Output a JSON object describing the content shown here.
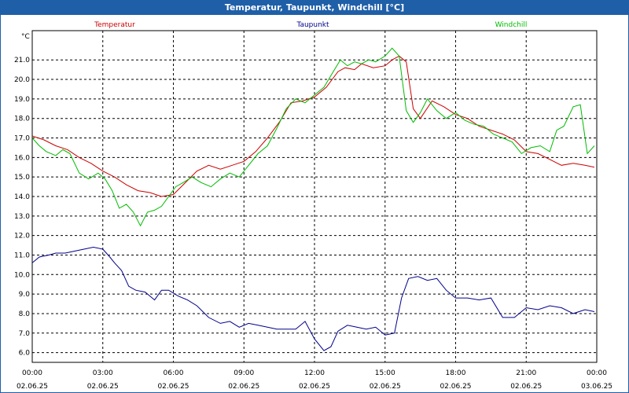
{
  "window": {
    "title": "Temperatur, Taupunkt, Windchill [°C]"
  },
  "chart_data": {
    "type": "line",
    "ylabel": "°C",
    "ylim": [
      5.5,
      22.5
    ],
    "yticks": [
      6.0,
      7.0,
      8.0,
      9.0,
      10.0,
      11.0,
      12.0,
      13.0,
      14.0,
      15.0,
      16.0,
      17.0,
      18.0,
      19.0,
      20.0,
      21.0
    ],
    "xlim": [
      0,
      24
    ],
    "xticks": [
      {
        "time": "00:00",
        "date": "02.06.25"
      },
      {
        "time": "03:00",
        "date": "02.06.25"
      },
      {
        "time": "06:00",
        "date": "02.06.25"
      },
      {
        "time": "09:00",
        "date": "02.06.25"
      },
      {
        "time": "12:00",
        "date": "02.06.25"
      },
      {
        "time": "15:00",
        "date": "02.06.25"
      },
      {
        "time": "18:00",
        "date": "02.06.25"
      },
      {
        "time": "21:00",
        "date": "02.06.25"
      },
      {
        "time": "00:00",
        "date": "03.06.25"
      }
    ],
    "grid": true,
    "legend": "top",
    "series": [
      {
        "name": "Temperatur",
        "color": "#cc0000",
        "x": [
          0,
          0.5,
          1,
          1.5,
          2,
          2.5,
          3,
          3.5,
          4,
          4.5,
          5,
          5.5,
          6,
          6.5,
          7,
          7.5,
          8,
          8.5,
          9,
          9.5,
          10,
          10.5,
          11,
          11.5,
          12,
          12.5,
          13,
          13.3,
          13.7,
          14,
          14.5,
          15,
          15.3,
          15.6,
          15.9,
          16.2,
          16.5,
          17,
          17.5,
          18,
          18.5,
          19,
          19.5,
          20,
          20.5,
          21,
          21.5,
          22,
          22.5,
          23,
          23.5,
          23.9
        ],
        "y": [
          17.1,
          16.9,
          16.6,
          16.4,
          16.0,
          15.7,
          15.3,
          15.0,
          14.6,
          14.3,
          14.2,
          14.0,
          14.1,
          14.7,
          15.3,
          15.6,
          15.4,
          15.6,
          15.8,
          16.3,
          17.0,
          17.8,
          18.8,
          18.9,
          19.1,
          19.6,
          20.4,
          20.6,
          20.5,
          20.8,
          20.6,
          20.7,
          21.0,
          21.2,
          20.9,
          18.5,
          18.0,
          18.9,
          18.6,
          18.2,
          18.0,
          17.6,
          17.4,
          17.2,
          16.9,
          16.3,
          16.2,
          15.9,
          15.6,
          15.7,
          15.6,
          15.5
        ]
      },
      {
        "name": "Taupunkt",
        "color": "#00008b",
        "x": [
          0,
          0.3,
          0.7,
          1,
          1.4,
          1.8,
          2.2,
          2.6,
          3,
          3.3,
          3.5,
          3.8,
          4.1,
          4.4,
          4.8,
          5.2,
          5.5,
          5.8,
          6.2,
          6.6,
          7,
          7.5,
          8,
          8.4,
          8.8,
          9.2,
          9.6,
          10,
          10.4,
          10.8,
          11.2,
          11.6,
          12,
          12.4,
          12.7,
          13,
          13.4,
          13.8,
          14.2,
          14.6,
          15,
          15.4,
          15.7,
          16,
          16.4,
          16.8,
          17.2,
          17.6,
          18,
          18.5,
          19,
          19.5,
          20,
          20.5,
          21,
          21.5,
          22,
          22.5,
          23,
          23.5,
          23.9
        ],
        "y": [
          10.6,
          10.9,
          11.0,
          11.1,
          11.1,
          11.2,
          11.3,
          11.4,
          11.3,
          10.9,
          10.6,
          10.2,
          9.4,
          9.2,
          9.1,
          8.7,
          9.2,
          9.2,
          8.9,
          8.7,
          8.4,
          7.8,
          7.5,
          7.6,
          7.3,
          7.5,
          7.4,
          7.3,
          7.2,
          7.2,
          7.2,
          7.6,
          6.7,
          6.1,
          6.3,
          7.1,
          7.4,
          7.3,
          7.2,
          7.3,
          6.9,
          7.0,
          8.8,
          9.8,
          9.9,
          9.7,
          9.8,
          9.2,
          8.8,
          8.8,
          8.7,
          8.8,
          7.8,
          7.8,
          8.3,
          8.2,
          8.4,
          8.3,
          8.0,
          8.2,
          8.1
        ]
      },
      {
        "name": "Windchill",
        "color": "#00bb00",
        "x": [
          0,
          0.3,
          0.6,
          1,
          1.3,
          1.6,
          2,
          2.4,
          2.8,
          3.1,
          3.4,
          3.7,
          4,
          4.3,
          4.6,
          4.9,
          5.2,
          5.5,
          5.8,
          6.1,
          6.4,
          6.8,
          7.2,
          7.6,
          8,
          8.4,
          8.8,
          9.2,
          9.6,
          10,
          10.4,
          10.8,
          11.2,
          11.6,
          12,
          12.4,
          12.8,
          13.1,
          13.4,
          13.7,
          14,
          14.3,
          14.6,
          15,
          15.3,
          15.6,
          15.9,
          16.2,
          16.5,
          16.8,
          17.2,
          17.6,
          18,
          18.4,
          18.8,
          19.2,
          19.6,
          20,
          20.4,
          20.8,
          21.2,
          21.6,
          22,
          22.3,
          22.6,
          23,
          23.3,
          23.6,
          23.9
        ],
        "y": [
          17.0,
          16.6,
          16.3,
          16.1,
          16.4,
          16.2,
          15.2,
          14.9,
          15.2,
          14.9,
          14.3,
          13.4,
          13.6,
          13.2,
          12.5,
          13.2,
          13.3,
          13.5,
          14.0,
          14.5,
          14.7,
          15.0,
          14.7,
          14.5,
          14.9,
          15.2,
          15.0,
          15.6,
          16.2,
          16.6,
          17.5,
          18.5,
          19.0,
          18.8,
          19.2,
          19.6,
          20.4,
          21.0,
          20.7,
          20.9,
          20.8,
          21.0,
          20.9,
          21.2,
          21.6,
          21.2,
          18.4,
          17.8,
          18.3,
          19.0,
          18.4,
          18.0,
          18.3,
          17.9,
          17.7,
          17.6,
          17.2,
          17.0,
          16.8,
          16.2,
          16.5,
          16.6,
          16.3,
          17.4,
          17.6,
          18.6,
          18.7,
          16.2,
          16.6
        ]
      }
    ]
  }
}
